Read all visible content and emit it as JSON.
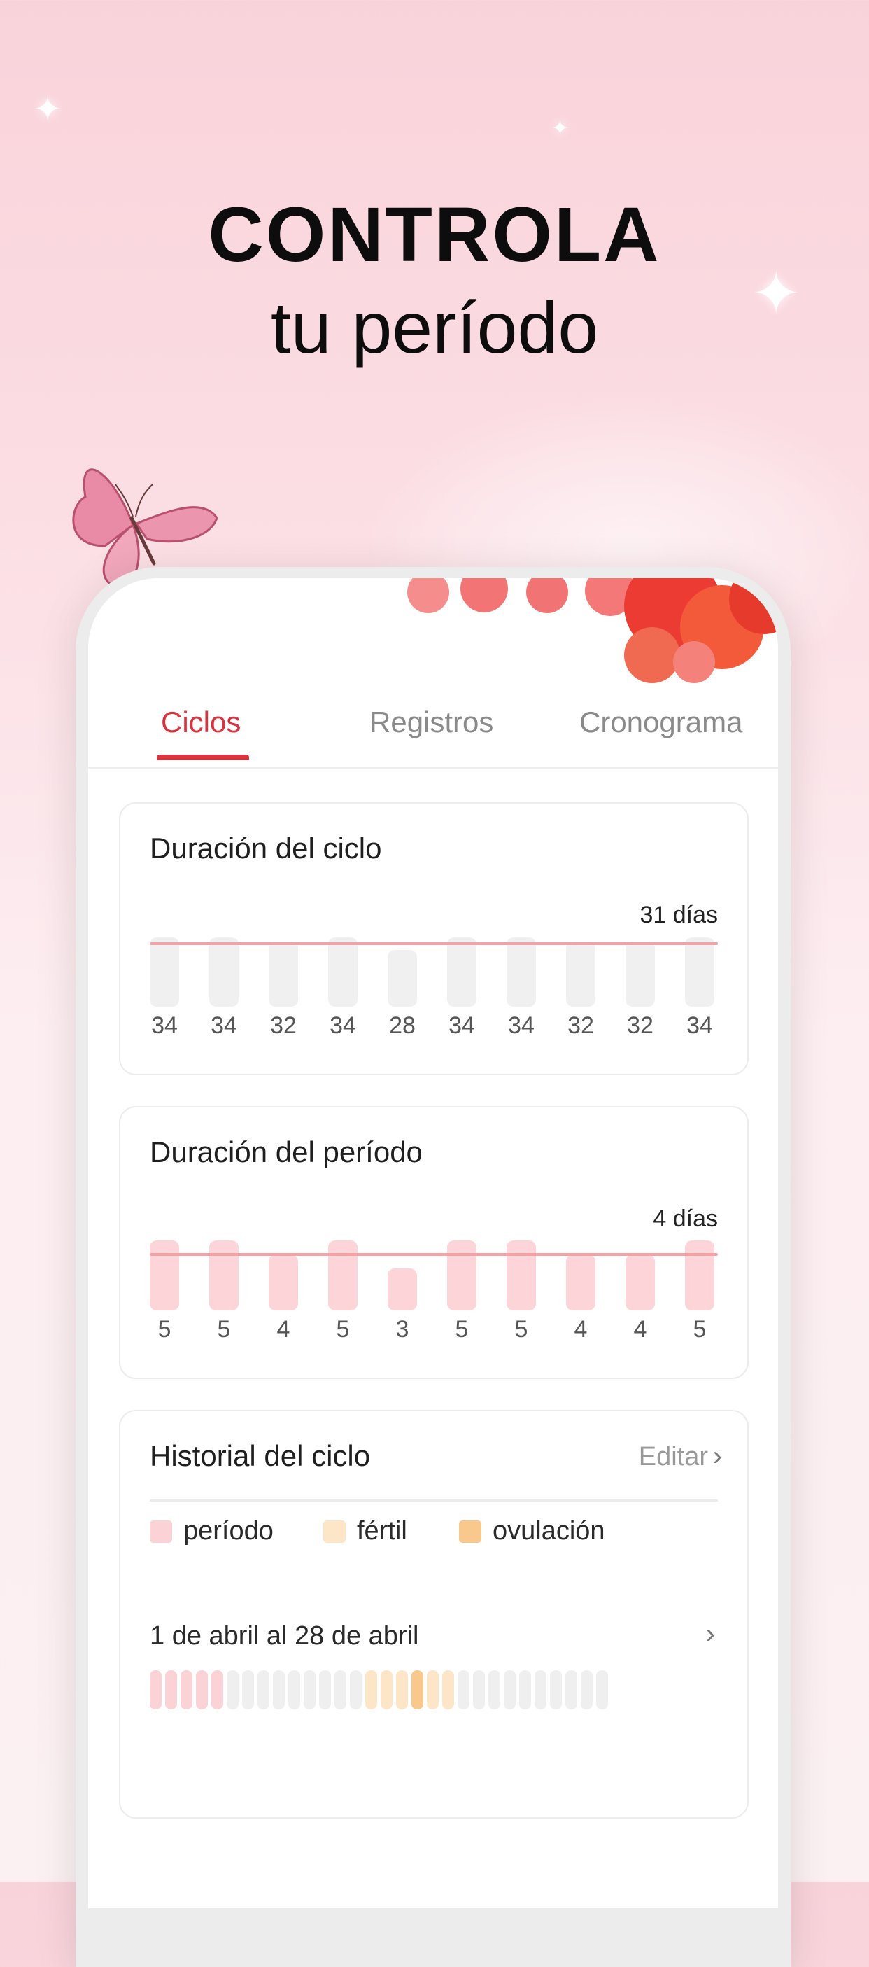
{
  "headline": {
    "line1": "CONTROLA",
    "line2": "tu período"
  },
  "tabs": [
    {
      "label": "Ciclos",
      "active": true
    },
    {
      "label": "Registros",
      "active": false
    },
    {
      "label": "Cronograma",
      "active": false
    }
  ],
  "cycle_card": {
    "title": "Duración del ciclo",
    "average_label": "31 días",
    "average": 31,
    "values": [
      "34",
      "34",
      "32",
      "34",
      "28",
      "34",
      "34",
      "32",
      "32",
      "34"
    ]
  },
  "period_card": {
    "title": "Duración del período",
    "average_label": "4 días",
    "average": 4,
    "values": [
      "5",
      "5",
      "4",
      "5",
      "3",
      "5",
      "5",
      "4",
      "4",
      "5"
    ]
  },
  "history_card": {
    "title": "Historial del ciclo",
    "edit_label": "Editar",
    "legend": [
      {
        "label": "período",
        "color": "#fbd2d5"
      },
      {
        "label": "fértil",
        "color": "#fde6c8"
      },
      {
        "label": "ovulación",
        "color": "#f8c88c"
      }
    ],
    "range_label": "1 de abril al 28 de abril",
    "days": [
      "period",
      "period",
      "period",
      "period",
      "period",
      "none",
      "none",
      "none",
      "none",
      "none",
      "none",
      "none",
      "none",
      "none",
      "fertile",
      "fertile",
      "fertile",
      "ovulation",
      "fertile",
      "fertile",
      "none",
      "none",
      "none",
      "none",
      "none",
      "none",
      "none",
      "none",
      "none",
      "none"
    ]
  },
  "colors": {
    "accent": "#d9333f",
    "cycle_bar": "#f0f0f0",
    "period_bar": "#fdd4d7",
    "average_line": "#f2a3a8",
    "none_day": "#efefef"
  }
}
